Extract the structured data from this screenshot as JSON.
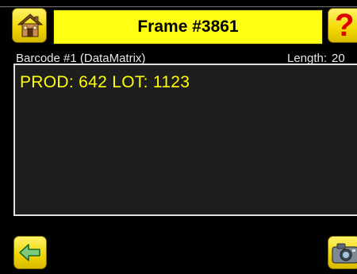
{
  "header": {
    "title": "Frame #3861",
    "help_label": "?",
    "home_icon": "home-icon",
    "help_icon": "question-icon"
  },
  "info": {
    "symbol": "Barcode #1 (DataMatrix)",
    "length_label": "Length:",
    "length_value": "20"
  },
  "result": {
    "text": "PROD: 642  LOT: 1123"
  },
  "footer": {
    "back_icon": "arrow-left-icon",
    "camera_icon": "camera-icon"
  },
  "colors": {
    "title_bar": "#ffff14",
    "result_text": "#ffff00",
    "button_yellow": "#f0d400",
    "help_glyph": "#e00000",
    "background": "#000000",
    "panel": "#1e1e1e"
  }
}
